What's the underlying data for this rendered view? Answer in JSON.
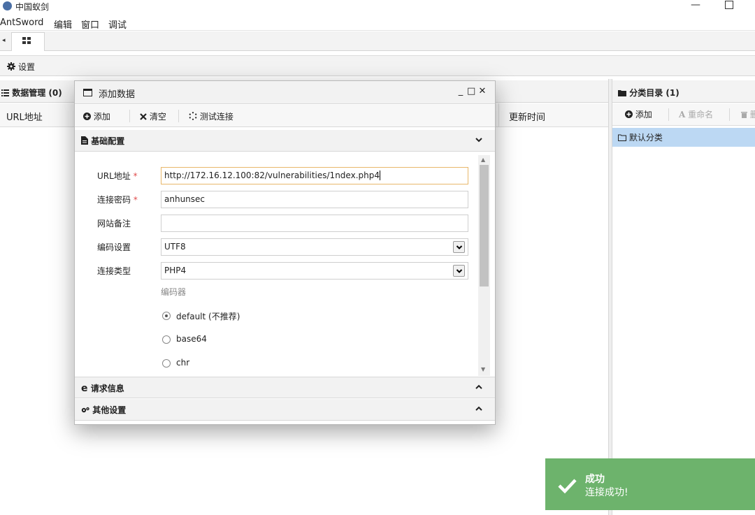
{
  "window": {
    "title": "中国蚁剑",
    "minimize_glyph": "—"
  },
  "menubar": {
    "items": [
      "AntSword",
      "编辑",
      "窗口",
      "调试"
    ]
  },
  "tabs": {
    "arrow": "◂"
  },
  "settings": {
    "label": "设置"
  },
  "data_panel": {
    "title": "数据管理 (0)",
    "columns": [
      "URL地址",
      "更新时间"
    ]
  },
  "category_panel": {
    "title": "分类目录 (1)",
    "buttons": {
      "add": "添加",
      "rename": "重命名",
      "delete": "删"
    },
    "items": [
      "默认分类"
    ]
  },
  "modal": {
    "title": "添加数据",
    "controls": {
      "min": "_",
      "max": "□",
      "close": "✕"
    },
    "toolbar": {
      "add": "添加",
      "clear": "清空",
      "test": "测试连接"
    },
    "sections": {
      "basic": "基础配置",
      "request": "请求信息",
      "other": "其他设置"
    },
    "form": {
      "url_label": "URL地址",
      "url_value": "http://172.16.12.100:82/vulnerabilities/1ndex.php4",
      "password_label": "连接密码",
      "password_value": "anhunsec",
      "note_label": "网站备注",
      "note_value": "",
      "encoding_label": "编码设置",
      "encoding_value": "UTF8",
      "type_label": "连接类型",
      "type_value": "PHP4",
      "encoder_label": "编码器",
      "encoders": [
        "default (不推荐)",
        "base64",
        "chr"
      ],
      "encoder_selected": "default (不推荐)",
      "required_mark": "*"
    }
  },
  "toast": {
    "title": "成功",
    "message": "连接成功!",
    "color": "#6db36c"
  }
}
